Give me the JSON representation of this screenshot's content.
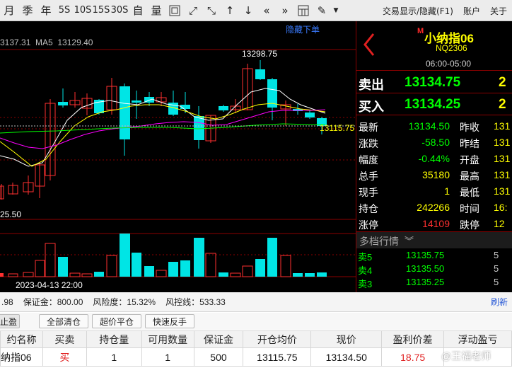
{
  "toolbar": {
    "period_month": "月",
    "period_quarter": "季",
    "period_year": "年",
    "period_5s": "5S",
    "period_10s": "10S",
    "period_15s": "15S",
    "period_30s": "30S",
    "custom": "自",
    "volume": "量",
    "menu_label": "交易显示/隐藏(F1)",
    "account": "账户",
    "about": "关于"
  },
  "chart": {
    "hide_order_link": "隐藏下单",
    "ma_line": "3137.31  MA5  13129.40",
    "high_label": "13298.75",
    "low_label": "25.50",
    "price_marker": "13115.75",
    "date_label": "2023-04-13 22:00",
    "colors": {
      "up": "#ff3030",
      "down": "#00e5e5",
      "ma5": "#ffffff",
      "ma10": "#ffff00",
      "ma20": "#ff00ff",
      "ma60": "#00ff00"
    }
  },
  "quote": {
    "flag": "M",
    "name": "小纳指06",
    "code": "NQ2306",
    "session": "06:00-05:00",
    "sell_label": "卖出",
    "sell_price": "13134.75",
    "sell_qty": "2",
    "buy_label": "买入",
    "buy_price": "13134.25",
    "buy_qty": "2",
    "rows": [
      {
        "l1": "最新",
        "v1": "13134.50",
        "c1": "#00ff00",
        "l2": "昨收",
        "v2": "131"
      },
      {
        "l1": "涨跌",
        "v1": "-58.50",
        "c1": "#00ff00",
        "l2": "昨结",
        "v2": "131"
      },
      {
        "l1": "幅度",
        "v1": "-0.44%",
        "c1": "#00ff00",
        "l2": "开盘",
        "v2": "131"
      },
      {
        "l1": "总手",
        "v1": "35180",
        "c1": "#ffff00",
        "l2": "最高",
        "v2": "131"
      },
      {
        "l1": "现手",
        "v1": "1",
        "c1": "#ffff00",
        "l2": "最低",
        "v2": "131"
      },
      {
        "l1": "持仓",
        "v1": "242266",
        "c1": "#ffff00",
        "l2": "时间",
        "v2": "16:"
      },
      {
        "l1": "涨停",
        "v1": "14109",
        "c1": "#ff3030",
        "l2": "跌停",
        "v2": "12"
      }
    ],
    "depth_title": "多档行情",
    "depth": [
      {
        "label": "卖5",
        "price": "13135.75",
        "qty": "5"
      },
      {
        "label": "卖4",
        "price": "13135.50",
        "qty": "5"
      },
      {
        "label": "卖3",
        "price": "13135.25",
        "qty": "5"
      }
    ]
  },
  "status": {
    "equity": ".98",
    "margin": "保证金：800.00",
    "risk": "风险度：15.32%",
    "stopline": "风控线：533.33",
    "refresh": "刷新"
  },
  "buttons": {
    "stop": "止盈",
    "close_all": "全部清仓",
    "close_even": "超价平仓",
    "reverse": "快速反手"
  },
  "positions": {
    "headers": [
      "约名称",
      "买卖",
      "持仓量",
      "可用数量",
      "保证金",
      "开仓均价",
      "现价",
      "盈利价差",
      "浮动盈亏"
    ],
    "rows": [
      {
        "name": "纳指06",
        "side": "买",
        "qty": "1",
        "avail": "1",
        "margin": "500",
        "open": "13115.75",
        "price": "13134.50",
        "diff": "18.75",
        "pnl": ""
      }
    ]
  },
  "watermark": "@王福老师"
}
